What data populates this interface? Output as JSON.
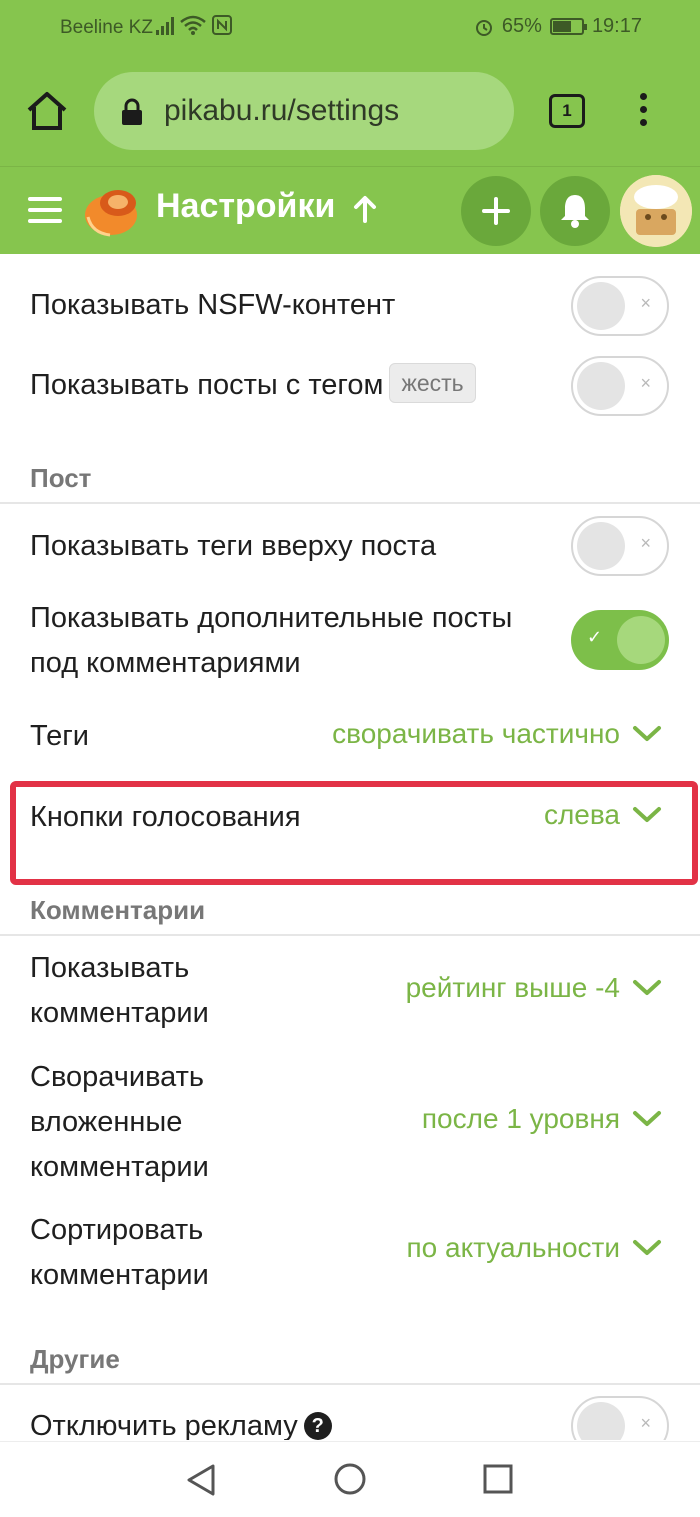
{
  "status_bar": {
    "carrier": "Beeline KZ",
    "battery": "65%",
    "time": "19:17"
  },
  "browser": {
    "url": "pikabu.ru/settings",
    "tab_count": "1"
  },
  "app_bar": {
    "title": "Настройки"
  },
  "colors": {
    "brand_green": "#86c54e",
    "accent_green": "#7bb546",
    "highlight_red": "#e23246"
  },
  "settings": {
    "nsfw": {
      "label": "Показывать NSFW-контент",
      "enabled": false
    },
    "tag_posts": {
      "label": "Показывать посты с тегом",
      "tag": "жесть",
      "enabled": false
    },
    "post_section": {
      "title": "Пост"
    },
    "tags_top": {
      "label": "Показывать теги вверху поста",
      "enabled": false
    },
    "extra_posts": {
      "label_line1": "Показывать дополнительные посты",
      "label_line2": "под комментариями",
      "enabled": true
    },
    "tags": {
      "label": "Теги",
      "value": "сворачивать частично"
    },
    "vote_buttons": {
      "label": "Кнопки голосования",
      "value": "слева"
    },
    "comments_section": {
      "title": "Комментарии"
    },
    "show_comments": {
      "label_line1": "Показывать",
      "label_line2": "комментарии",
      "value": "рейтинг выше -4"
    },
    "collapse_nested": {
      "label_line1": "Сворачивать",
      "label_line2": "вложенные",
      "label_line3": "комментарии",
      "value": "после 1 уровня"
    },
    "sort_comments": {
      "label_line1": "Сортировать",
      "label_line2": "комментарии",
      "value": "по актуальности"
    },
    "other_section": {
      "title": "Другие"
    },
    "disable_ads": {
      "label": "Отключить рекламу",
      "help": "?",
      "enabled": false
    }
  },
  "icons": [
    "home-icon",
    "lock-icon",
    "tabs-icon",
    "menu-icon",
    "pikabu-logo-icon",
    "arrow-up-icon",
    "plus-icon",
    "bell-icon",
    "chevron-down-icon",
    "help-icon",
    "nav-back-icon",
    "nav-home-icon",
    "nav-recent-icon"
  ]
}
